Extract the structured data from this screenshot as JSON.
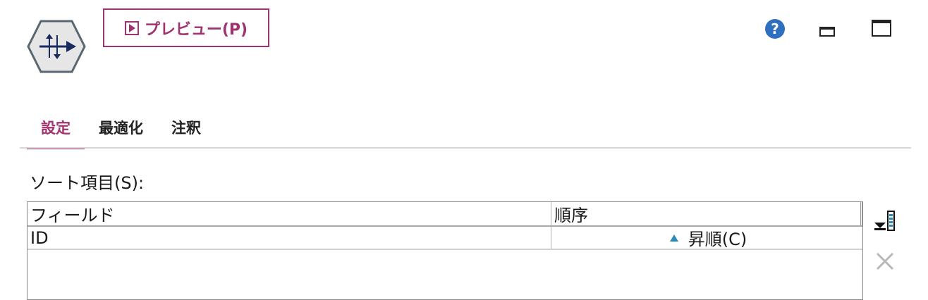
{
  "toolbar": {
    "preview_label": "プレビュー(P)",
    "node_icon": "sort-node-icon",
    "help_icon": "help-icon",
    "minimize_icon": "minimize-icon",
    "maximize_icon": "maximize-icon"
  },
  "tabs": [
    {
      "label": "設定",
      "active": true
    },
    {
      "label": "最適化",
      "active": false
    },
    {
      "label": "注釈",
      "active": false
    }
  ],
  "sort_section": {
    "label": "ソート項目(S):",
    "columns": [
      "フィールド",
      "順序"
    ],
    "rows": [
      {
        "field": "ID",
        "order": "昇順(C)",
        "order_icon": "ascending-triangle-icon"
      }
    ]
  },
  "side_tools": {
    "pick_fields_icon": "sort-fields-picker-icon",
    "delete_icon": "delete-x-icon"
  },
  "colors": {
    "accent": "#a0336f",
    "help": "#2f6fc0",
    "node_fill": "#e6e6e6",
    "ascending": "#2a8ab8"
  }
}
